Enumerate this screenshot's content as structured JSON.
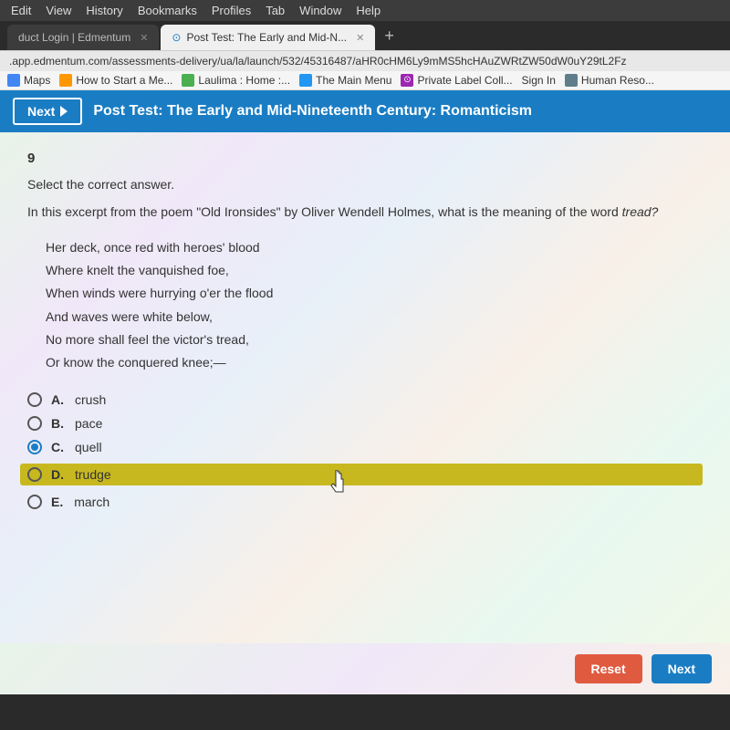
{
  "browser": {
    "menu_items": [
      "Edit",
      "View",
      "History",
      "Bookmarks",
      "Profiles",
      "Tab",
      "Window",
      "Help"
    ],
    "tabs": [
      {
        "label": "duct Login | Edmentum",
        "active": false
      },
      {
        "label": "Post Test: The Early and Mid-N...",
        "active": true
      }
    ],
    "tab_add_label": "+",
    "address_bar": ".app.edmentum.com/assessments-delivery/ua/la/launch/532/45316487/aHR0cHM6Ly9mMS5hcHAuZWRtZW50dW0uY29tL2Fz",
    "bookmarks": [
      {
        "label": "Maps",
        "type": "maps"
      },
      {
        "label": "How to Start a Me...",
        "type": "howto"
      },
      {
        "label": "Laulima : Home :...",
        "type": "laulima"
      },
      {
        "label": "The Main Menu",
        "type": "main"
      },
      {
        "label": "Private Label Coll...",
        "type": "private"
      },
      {
        "label": "Sign In",
        "type": "signin"
      },
      {
        "label": "Human Reso...",
        "type": "human"
      }
    ]
  },
  "test_header": {
    "next_label": "Next",
    "title": "Post Test: The Early and Mid-Nineteenth Century: Romanticism"
  },
  "question": {
    "number": "9",
    "instruction": "Select the correct answer.",
    "text": "In this excerpt from the poem \"Old Ironsides\" by Oliver Wendell Holmes, what is the meaning of the word",
    "keyword": "tread?",
    "poem_lines": [
      "Her deck, once red with heroes' blood",
      "Where knelt the vanquished foe,",
      "When winds were hurrying o'er the flood",
      "And waves were white below,",
      "No more shall feel the victor's tread,",
      "Or know the conquered knee;—"
    ],
    "options": [
      {
        "letter": "A.",
        "text": "crush",
        "selected": false,
        "highlighted": false
      },
      {
        "letter": "B.",
        "text": "pace",
        "selected": false,
        "highlighted": false
      },
      {
        "letter": "C.",
        "text": "quell",
        "selected": true,
        "highlighted": false
      },
      {
        "letter": "D.",
        "text": "trudge",
        "selected": false,
        "highlighted": true
      },
      {
        "letter": "E.",
        "text": "march",
        "selected": false,
        "highlighted": false
      }
    ]
  },
  "buttons": {
    "reset_label": "Reset",
    "next_label": "Next"
  }
}
